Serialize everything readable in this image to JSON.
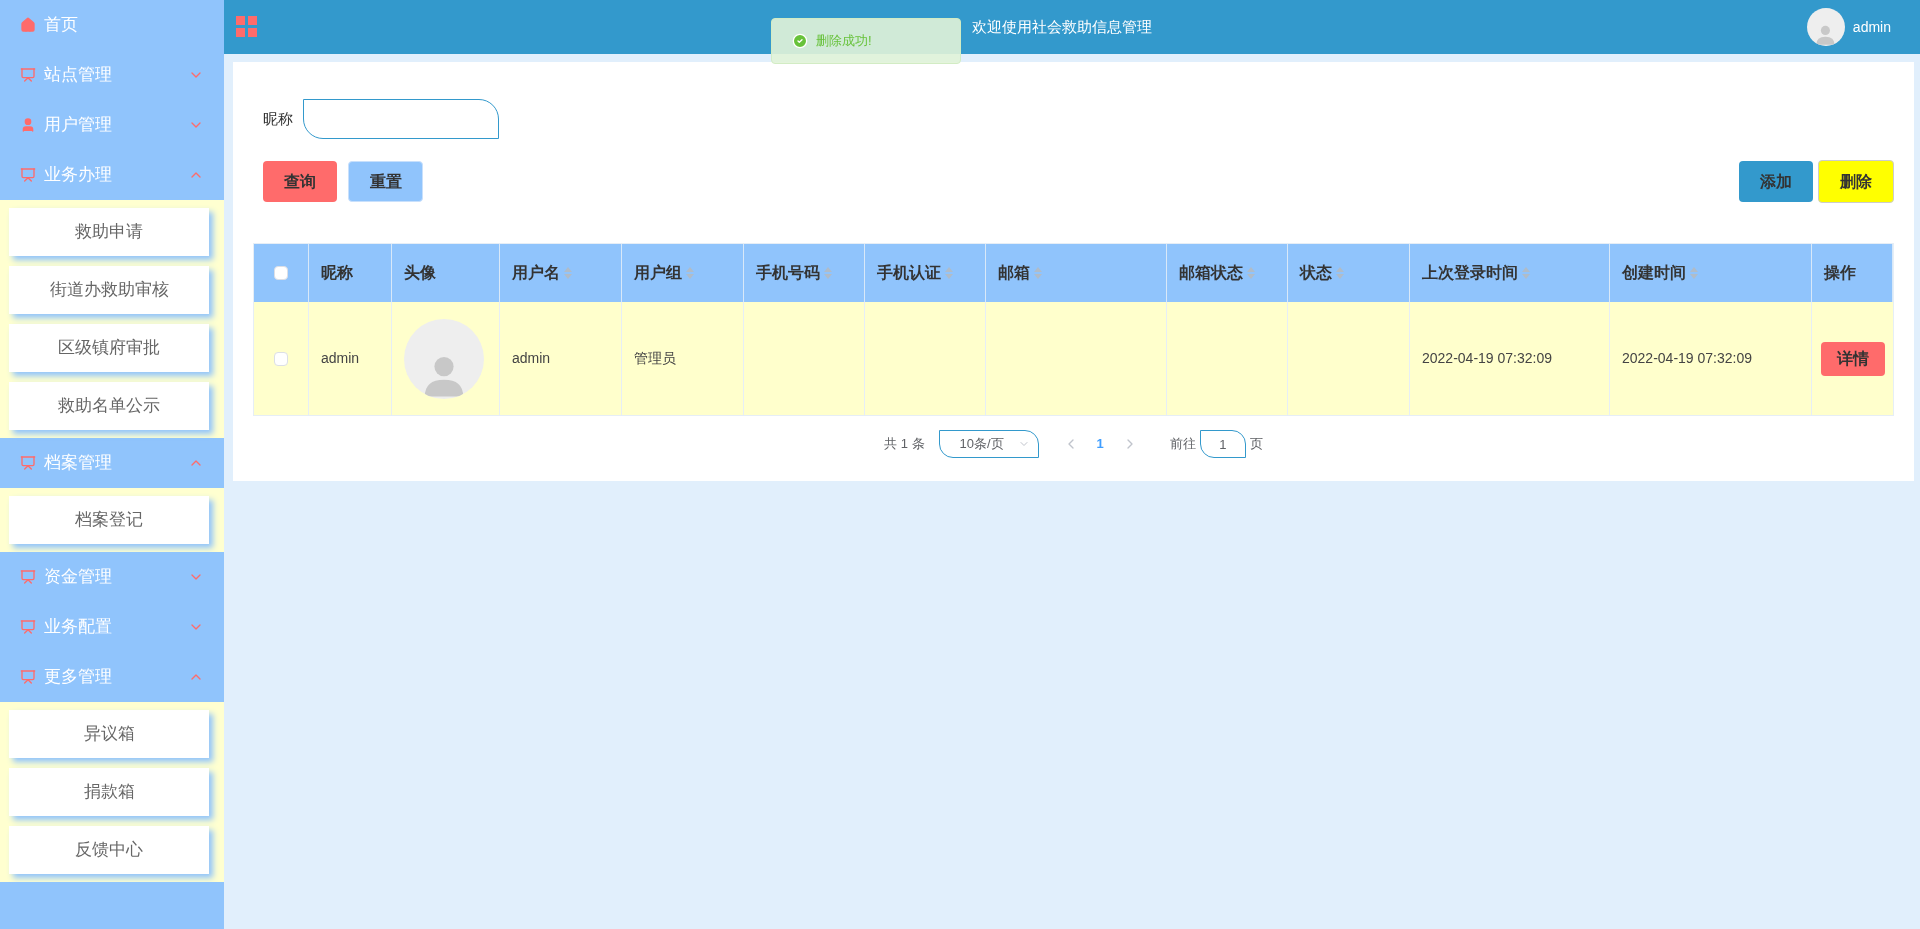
{
  "sidebar": {
    "items": [
      {
        "label": "首页",
        "kind": "home"
      },
      {
        "label": "站点管理",
        "kind": "board",
        "expanded": false
      },
      {
        "label": "用户管理",
        "kind": "user",
        "expanded": false
      },
      {
        "label": "业务办理",
        "kind": "board",
        "expanded": true,
        "children": [
          {
            "label": "救助申请"
          },
          {
            "label": "街道办救助审核"
          },
          {
            "label": "区级镇府审批"
          },
          {
            "label": "救助名单公示"
          }
        ]
      },
      {
        "label": "档案管理",
        "kind": "board",
        "expanded": true,
        "children": [
          {
            "label": "档案登记"
          }
        ]
      },
      {
        "label": "资金管理",
        "kind": "board",
        "expanded": false
      },
      {
        "label": "业务配置",
        "kind": "board",
        "expanded": false
      },
      {
        "label": "更多管理",
        "kind": "board",
        "expanded": true,
        "children": [
          {
            "label": "异议箱"
          },
          {
            "label": "捐款箱"
          },
          {
            "label": "反馈中心"
          }
        ]
      }
    ]
  },
  "header": {
    "title": "欢迎使用社会救助信息管理",
    "user": "admin"
  },
  "toast": {
    "message": "删除成功!"
  },
  "search": {
    "label": "昵称"
  },
  "buttons": {
    "query": "查询",
    "reset": "重置",
    "add": "添加",
    "delete": "删除"
  },
  "table": {
    "all_checked": false,
    "columns": [
      {
        "label": "昵称",
        "sortable": false
      },
      {
        "label": "头像",
        "sortable": false
      },
      {
        "label": "用户名",
        "sortable": true
      },
      {
        "label": "用户组",
        "sortable": true
      },
      {
        "label": "手机号码",
        "sortable": true
      },
      {
        "label": "手机认证",
        "sortable": true
      },
      {
        "label": "邮箱",
        "sortable": true
      },
      {
        "label": "邮箱状态",
        "sortable": true
      },
      {
        "label": "状态",
        "sortable": true
      },
      {
        "label": "上次登录时间",
        "sortable": true
      },
      {
        "label": "创建时间",
        "sortable": true
      },
      {
        "label": "操作",
        "sortable": false
      }
    ],
    "rows": [
      {
        "checked": false,
        "nickname": "admin",
        "username": "admin",
        "group": "管理员",
        "last_login": "2022-04-19 07:32:09",
        "created": "2022-04-19 07:32:09",
        "action": "详情"
      }
    ]
  },
  "pagination": {
    "total": "共 1 条",
    "page_size": "10条/页",
    "pages": [
      {
        "label": "1",
        "selected": true
      }
    ],
    "goto_label": "前往",
    "goto_value": "1",
    "goto_suffix": "页"
  }
}
